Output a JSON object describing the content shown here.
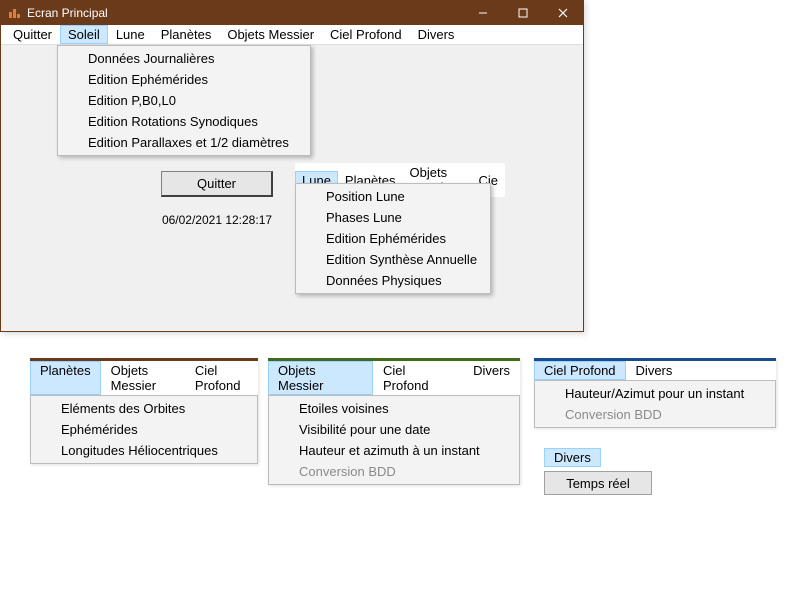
{
  "window": {
    "title": "Ecran Principal"
  },
  "menubar": {
    "items": [
      "Quitter",
      "Soleil",
      "Lune",
      "Planètes",
      "Objets Messier",
      "Ciel Profond",
      "Divers"
    ]
  },
  "soleil_menu": {
    "items": [
      "Données Journalières",
      "Edition Ephémérides",
      "Edition P,B0,L0",
      "Edition Rotations Synodiques",
      "Edition Parallaxes et 1/2 diamètres"
    ]
  },
  "quit_button": "Quitter",
  "timestamp": "06/02/2021 12:28:17",
  "lune_strip": {
    "tabs": [
      "Lune",
      "Planètes",
      "Objets Messier",
      "Cie"
    ],
    "items": [
      "Position Lune",
      "Phases Lune",
      "Edition Ephémérides",
      "Edition Synthèse Annuelle",
      "Données Physiques"
    ]
  },
  "planetes_frag": {
    "tabs": [
      "Planètes",
      "Objets Messier",
      "Ciel Profond"
    ],
    "items": [
      "Eléments des Orbites",
      "Ephémérides",
      "Longitudes Héliocentriques"
    ]
  },
  "messier_frag": {
    "tabs": [
      "Objets Messier",
      "Ciel Profond",
      "Divers"
    ],
    "items": [
      {
        "label": "Etoiles voisines",
        "disabled": false
      },
      {
        "label": "Visibilité pour une date",
        "disabled": false
      },
      {
        "label": "Hauteur et azimuth à un instant",
        "disabled": false
      },
      {
        "label": "Conversion BDD",
        "disabled": true
      }
    ]
  },
  "ciel_frag": {
    "tabs": [
      "Ciel Profond",
      "Divers"
    ],
    "items": [
      {
        "label": "Hauteur/Azimut pour un instant",
        "disabled": false
      },
      {
        "label": "Conversion BDD",
        "disabled": true
      }
    ]
  },
  "divers_frag": {
    "tab": "Divers",
    "button": "Temps réel"
  }
}
